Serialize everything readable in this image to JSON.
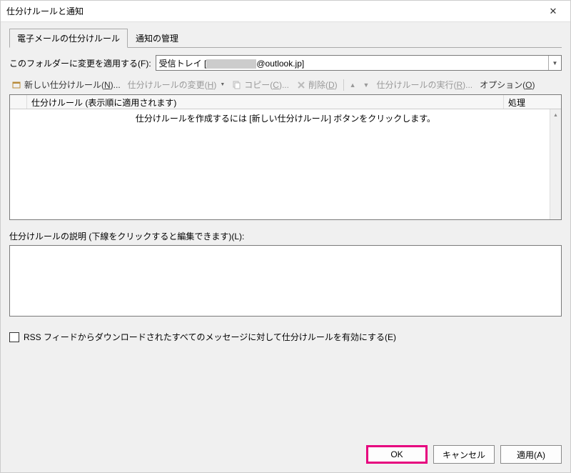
{
  "title": "仕分けルールと通知",
  "tabs": {
    "email_rules": "電子メールの仕分けルール",
    "notifications": "通知の管理"
  },
  "folder": {
    "label": "このフォルダーに変更を適用する(F):",
    "value_prefix": "受信トレイ [",
    "value_suffix": "@outlook.jp]"
  },
  "toolbar": {
    "new_rule": "新しい仕分けルール(N)...",
    "change_rule": "仕分けルールの変更(H)",
    "copy": "コピー(C)...",
    "delete": "削除(D)",
    "run_rules": "仕分けルールの実行(R)...",
    "options": "オプション(O)"
  },
  "columns": {
    "rule": "仕分けルール (表示順に適用されます)",
    "action": "処理"
  },
  "empty_message": "仕分けルールを作成するには [新しい仕分けルール] ボタンをクリックします。",
  "description_label": "仕分けルールの説明 (下線をクリックすると編集できます)(L):",
  "rss_label": "RSS フィードからダウンロードされたすべてのメッセージに対して仕分けルールを有効にする(E)",
  "buttons": {
    "ok": "OK",
    "cancel": "キャンセル",
    "apply": "適用(A)"
  }
}
